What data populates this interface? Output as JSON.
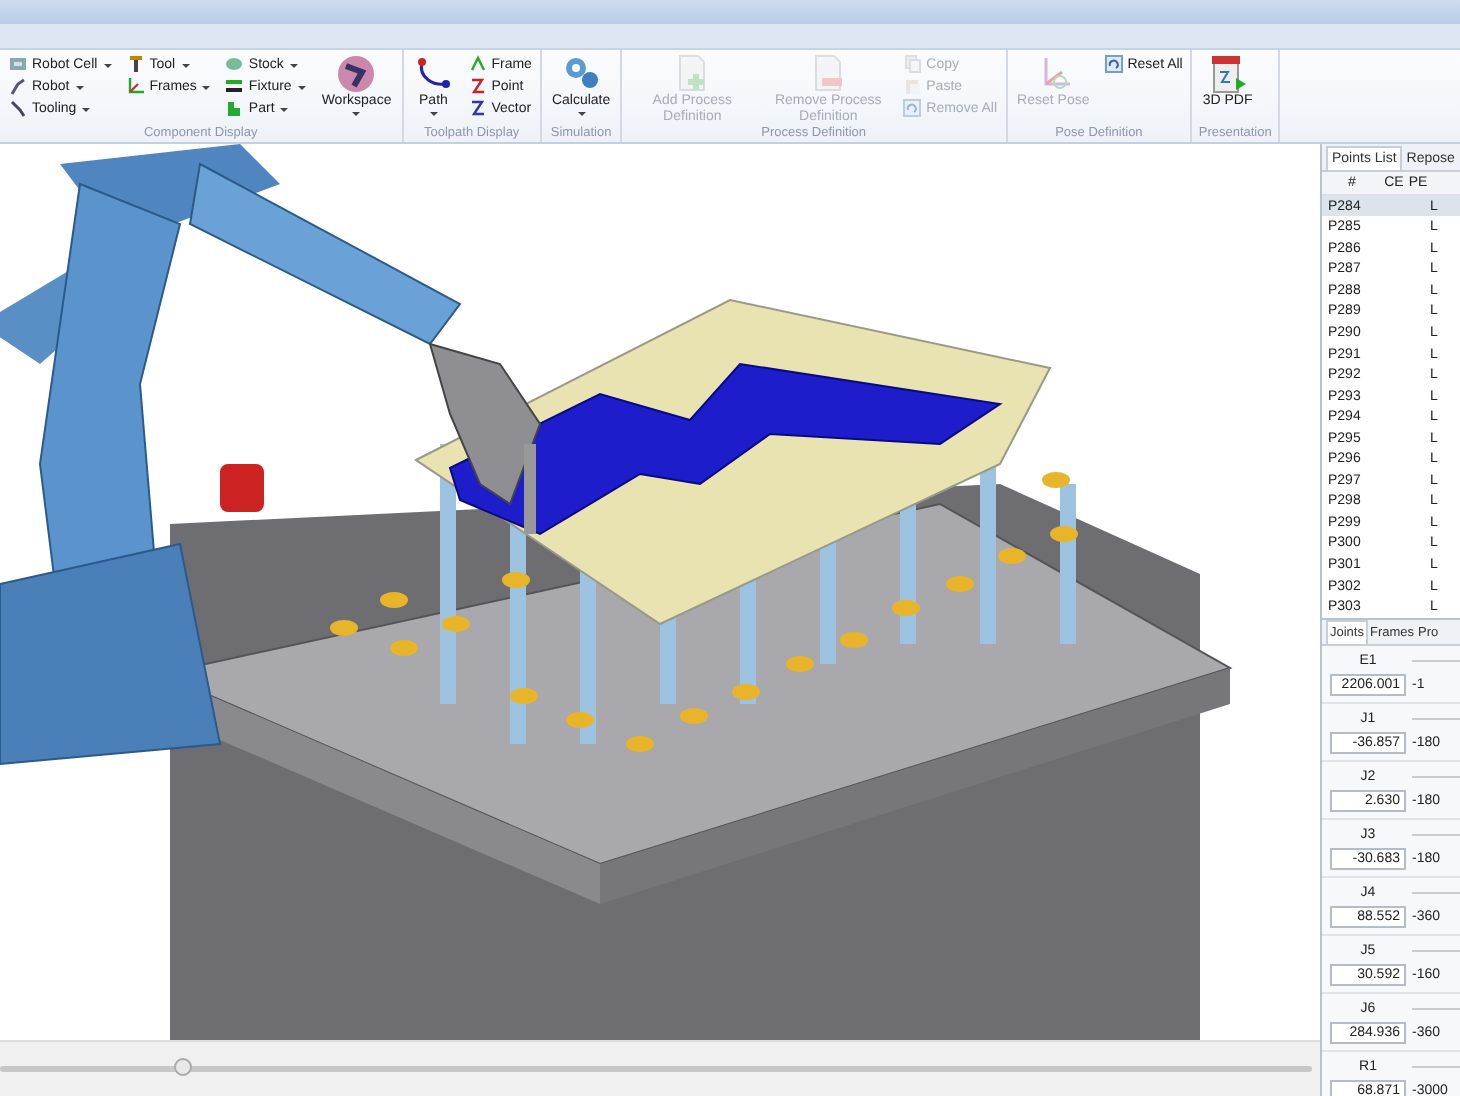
{
  "ribbon": {
    "groups": [
      {
        "label": "Component Display",
        "columns": [
          [
            {
              "kind": "small",
              "label": "Robot Cell",
              "dropdown": true,
              "disabled": false
            },
            {
              "kind": "small",
              "label": "Robot",
              "dropdown": true,
              "disabled": false
            },
            {
              "kind": "small",
              "label": "Tooling",
              "dropdown": true,
              "disabled": false
            }
          ],
          [
            {
              "kind": "small",
              "label": "Tool",
              "dropdown": true,
              "disabled": false
            },
            {
              "kind": "small",
              "label": "Frames",
              "dropdown": true,
              "disabled": false
            }
          ],
          [
            {
              "kind": "small",
              "label": "Stock",
              "dropdown": true,
              "disabled": false
            },
            {
              "kind": "small",
              "label": "Fixture",
              "dropdown": true,
              "disabled": false
            },
            {
              "kind": "small",
              "label": "Part",
              "dropdown": true,
              "disabled": false
            }
          ],
          [
            {
              "kind": "large",
              "label": "Workspace",
              "dropdown": true,
              "disabled": false
            }
          ]
        ]
      },
      {
        "label": "Toolpath Display",
        "columns": [
          [
            {
              "kind": "large",
              "label": "Path",
              "dropdown": true,
              "disabled": false
            }
          ],
          [
            {
              "kind": "small",
              "label": "Frame",
              "dropdown": false,
              "disabled": false
            },
            {
              "kind": "small",
              "label": "Point",
              "dropdown": false,
              "disabled": false
            },
            {
              "kind": "small",
              "label": "Vector",
              "dropdown": false,
              "disabled": false
            }
          ]
        ]
      },
      {
        "label": "Simulation",
        "columns": [
          [
            {
              "kind": "large",
              "label": "Calculate",
              "dropdown": true,
              "disabled": false
            }
          ]
        ]
      },
      {
        "label": "Process Definition",
        "columns": [
          [
            {
              "kind": "large",
              "label": "Add Process Definition",
              "dropdown": false,
              "disabled": true
            }
          ],
          [
            {
              "kind": "large",
              "label": "Remove Process Definition",
              "dropdown": false,
              "disabled": true
            }
          ],
          [
            {
              "kind": "small",
              "label": "Copy",
              "dropdown": false,
              "disabled": true
            },
            {
              "kind": "small",
              "label": "Paste",
              "dropdown": false,
              "disabled": true
            },
            {
              "kind": "small",
              "label": "Remove All",
              "dropdown": false,
              "disabled": true
            }
          ]
        ]
      },
      {
        "label": "Pose Definition",
        "columns": [
          [
            {
              "kind": "large",
              "label": "Reset Pose",
              "dropdown": false,
              "disabled": true
            }
          ],
          [
            {
              "kind": "small",
              "label": "Reset All",
              "dropdown": false,
              "disabled": false
            }
          ]
        ]
      },
      {
        "label": "Presentation",
        "columns": [
          [
            {
              "kind": "large",
              "label": "3D PDF",
              "dropdown": false,
              "disabled": false
            }
          ]
        ]
      }
    ]
  },
  "points_panel": {
    "tabs": [
      {
        "label": "Points List",
        "selected": true
      },
      {
        "label": "Repose",
        "selected": false
      }
    ],
    "columns": [
      "#",
      "CE",
      "PE"
    ],
    "rows": [
      {
        "name": "P284",
        "column_4": "L",
        "selected": true
      },
      {
        "name": "P285",
        "column_4": "L",
        "selected": false
      },
      {
        "name": "P286",
        "column_4": "L",
        "selected": false
      },
      {
        "name": "P287",
        "column_4": "L",
        "selected": false
      },
      {
        "name": "P288",
        "column_4": "L",
        "selected": false
      },
      {
        "name": "P289",
        "column_4": "L",
        "selected": false
      },
      {
        "name": "P290",
        "column_4": "L",
        "selected": false
      },
      {
        "name": "P291",
        "column_4": "L",
        "selected": false
      },
      {
        "name": "P292",
        "column_4": "L",
        "selected": false
      },
      {
        "name": "P293",
        "column_4": "L",
        "selected": false
      },
      {
        "name": "P294",
        "column_4": "L",
        "selected": false
      },
      {
        "name": "P295",
        "column_4": "L",
        "selected": false
      },
      {
        "name": "P296",
        "column_4": "L",
        "selected": false
      },
      {
        "name": "P297",
        "column_4": "L",
        "selected": false
      },
      {
        "name": "P298",
        "column_4": "L",
        "selected": false
      },
      {
        "name": "P299",
        "column_4": "L",
        "selected": false
      },
      {
        "name": "P300",
        "column_4": "L",
        "selected": false
      },
      {
        "name": "P301",
        "column_4": "L",
        "selected": false
      },
      {
        "name": "P302",
        "column_4": "L",
        "selected": false
      },
      {
        "name": "P303",
        "column_4": "L",
        "selected": false
      }
    ]
  },
  "joints_panel": {
    "tabs": [
      {
        "label": "Joints",
        "selected": true
      },
      {
        "label": "Frames",
        "selected": false
      },
      {
        "label": "Pro",
        "selected": false
      }
    ],
    "joints": [
      {
        "name": "E1",
        "value": "2206.001",
        "min": "-1"
      },
      {
        "name": "J1",
        "value": "-36.857",
        "min": "-180"
      },
      {
        "name": "J2",
        "value": "2.630",
        "min": "-180"
      },
      {
        "name": "J3",
        "value": "-30.683",
        "min": "-180"
      },
      {
        "name": "J4",
        "value": "88.552",
        "min": "-360"
      },
      {
        "name": "J5",
        "value": "30.592",
        "min": "-160"
      },
      {
        "name": "J6",
        "value": "284.936",
        "min": "-360"
      },
      {
        "name": "R1",
        "value": "68.871",
        "min": "-3000"
      }
    ]
  },
  "timeline": {
    "level": 0.14
  }
}
